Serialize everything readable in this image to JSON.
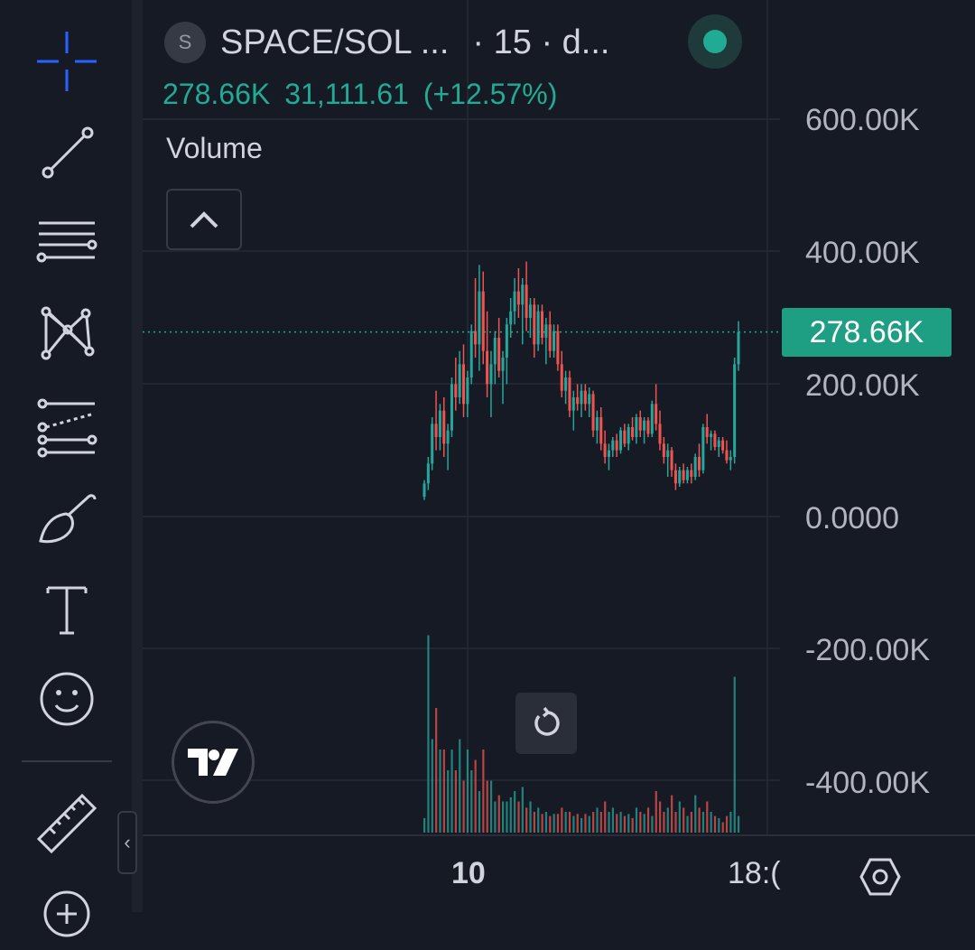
{
  "header": {
    "symbol_logo": "S",
    "symbol": "SPACE/SOL ...",
    "interval": "· 15 · d...",
    "market_status_color": "#22ab94"
  },
  "legend": {
    "last_value": "278.66K",
    "change": "31,111.61",
    "change_pct": "(+12.57%)",
    "indicator": "Volume"
  },
  "price_axis": {
    "labels": [
      "600.00K",
      "400.00K",
      "200.00K",
      "0.0000",
      "-200.00K",
      "-400.00K"
    ],
    "last_price_tag": "278.66K"
  },
  "time_axis": {
    "labels": [
      "10",
      "18:("
    ]
  },
  "toolbar": {
    "icons": [
      "crosshair-icon",
      "trend-line-icon",
      "horizontal-lines-icon",
      "pattern-icon",
      "forecast-icon",
      "brush-icon",
      "text-icon",
      "emoji-icon",
      "ruler-icon",
      "zoom-in-icon"
    ]
  },
  "colors": {
    "up": "#26a69a",
    "down": "#ef5350",
    "accent": "#2962ff",
    "background": "#161a25"
  },
  "chart_data": {
    "type": "candlestick",
    "interval": "15",
    "ylim": [
      -500000,
      650000
    ],
    "last_price": 278660,
    "candles": [
      [
        30000,
        55000,
        25000,
        50000
      ],
      [
        50000,
        90000,
        40000,
        80000
      ],
      [
        80000,
        150000,
        70000,
        140000
      ],
      [
        140000,
        190000,
        100000,
        120000
      ],
      [
        120000,
        170000,
        100000,
        160000
      ],
      [
        160000,
        180000,
        90000,
        110000
      ],
      [
        110000,
        140000,
        70000,
        130000
      ],
      [
        130000,
        210000,
        120000,
        200000
      ],
      [
        200000,
        240000,
        160000,
        180000
      ],
      [
        180000,
        250000,
        170000,
        230000
      ],
      [
        230000,
        260000,
        150000,
        170000
      ],
      [
        170000,
        220000,
        150000,
        210000
      ],
      [
        210000,
        290000,
        200000,
        280000
      ],
      [
        280000,
        360000,
        240000,
        260000
      ],
      [
        260000,
        380000,
        220000,
        340000
      ],
      [
        340000,
        370000,
        230000,
        250000
      ],
      [
        250000,
        310000,
        180000,
        200000
      ],
      [
        200000,
        250000,
        150000,
        230000
      ],
      [
        230000,
        280000,
        200000,
        270000
      ],
      [
        270000,
        300000,
        210000,
        220000
      ],
      [
        220000,
        250000,
        170000,
        240000
      ],
      [
        240000,
        300000,
        200000,
        290000
      ],
      [
        290000,
        330000,
        270000,
        310000
      ],
      [
        310000,
        360000,
        290000,
        340000
      ],
      [
        340000,
        375000,
        300000,
        320000
      ],
      [
        320000,
        360000,
        260000,
        350000
      ],
      [
        350000,
        385000,
        280000,
        300000
      ],
      [
        300000,
        330000,
        270000,
        320000
      ],
      [
        320000,
        330000,
        240000,
        260000
      ],
      [
        260000,
        320000,
        250000,
        310000
      ],
      [
        310000,
        320000,
        260000,
        270000
      ],
      [
        270000,
        300000,
        230000,
        290000
      ],
      [
        290000,
        310000,
        240000,
        250000
      ],
      [
        250000,
        290000,
        240000,
        280000
      ],
      [
        280000,
        290000,
        220000,
        230000
      ],
      [
        230000,
        250000,
        180000,
        190000
      ],
      [
        190000,
        220000,
        170000,
        210000
      ],
      [
        210000,
        220000,
        150000,
        160000
      ],
      [
        160000,
        190000,
        130000,
        180000
      ],
      [
        180000,
        200000,
        160000,
        170000
      ],
      [
        170000,
        200000,
        150000,
        190000
      ],
      [
        190000,
        200000,
        160000,
        170000
      ],
      [
        170000,
        195000,
        150000,
        185000
      ],
      [
        185000,
        190000,
        120000,
        130000
      ],
      [
        130000,
        160000,
        110000,
        150000
      ],
      [
        150000,
        165000,
        100000,
        110000
      ],
      [
        110000,
        130000,
        80000,
        90000
      ],
      [
        90000,
        110000,
        70000,
        100000
      ],
      [
        100000,
        120000,
        90000,
        115000
      ],
      [
        115000,
        125000,
        90000,
        100000
      ],
      [
        100000,
        135000,
        95000,
        130000
      ],
      [
        130000,
        140000,
        105000,
        110000
      ],
      [
        110000,
        140000,
        100000,
        135000
      ],
      [
        135000,
        150000,
        115000,
        120000
      ],
      [
        120000,
        155000,
        110000,
        150000
      ],
      [
        150000,
        160000,
        120000,
        130000
      ],
      [
        130000,
        150000,
        110000,
        145000
      ],
      [
        145000,
        150000,
        120000,
        125000
      ],
      [
        125000,
        175000,
        120000,
        170000
      ],
      [
        170000,
        200000,
        130000,
        140000
      ],
      [
        140000,
        160000,
        100000,
        110000
      ],
      [
        110000,
        120000,
        80000,
        90000
      ],
      [
        90000,
        110000,
        60000,
        100000
      ],
      [
        100000,
        105000,
        60000,
        70000
      ],
      [
        70000,
        80000,
        40000,
        50000
      ],
      [
        50000,
        75000,
        45000,
        70000
      ],
      [
        70000,
        80000,
        50000,
        55000
      ],
      [
        55000,
        75000,
        50000,
        70000
      ],
      [
        70000,
        80000,
        50000,
        60000
      ],
      [
        60000,
        95000,
        55000,
        90000
      ],
      [
        90000,
        110000,
        60000,
        70000
      ],
      [
        70000,
        140000,
        65000,
        135000
      ],
      [
        135000,
        155000,
        110000,
        120000
      ],
      [
        120000,
        130000,
        100000,
        125000
      ],
      [
        125000,
        130000,
        100000,
        105000
      ],
      [
        105000,
        120000,
        90000,
        115000
      ],
      [
        115000,
        120000,
        95000,
        100000
      ],
      [
        100000,
        115000,
        80000,
        85000
      ],
      [
        85000,
        100000,
        70000,
        90000
      ],
      [
        90000,
        240000,
        80000,
        230000
      ],
      [
        230000,
        295000,
        220000,
        278660
      ]
    ],
    "volumes": [
      7,
      95,
      45,
      60,
      40,
      40,
      30,
      40,
      30,
      45,
      25,
      40,
      30,
      35,
      20,
      40,
      25,
      25,
      15,
      18,
      15,
      15,
      17,
      20,
      15,
      22,
      12,
      15,
      10,
      12,
      9,
      10,
      8,
      9,
      9,
      12,
      10,
      10,
      8,
      9,
      7,
      9,
      8,
      10,
      12,
      10,
      15,
      10,
      12,
      9,
      10,
      8,
      9,
      7,
      12,
      10,
      9,
      12,
      8,
      20,
      15,
      10,
      12,
      18,
      10,
      15,
      12,
      8,
      10,
      18,
      12,
      10,
      15,
      10,
      8,
      7,
      5,
      8,
      10,
      75,
      8
    ]
  }
}
